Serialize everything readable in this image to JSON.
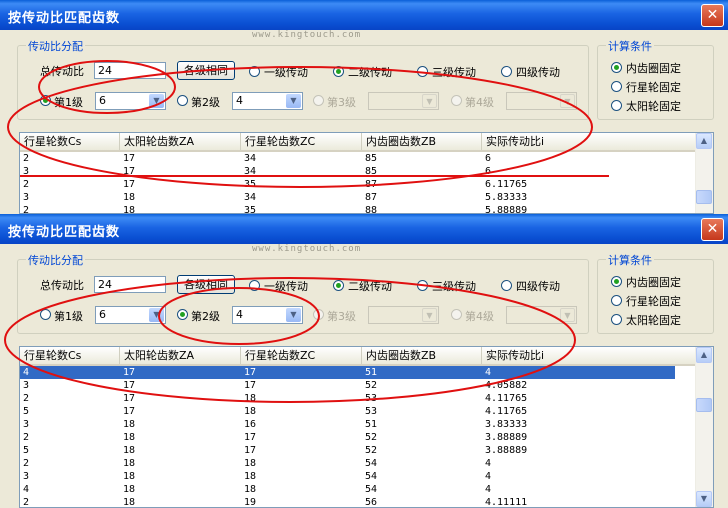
{
  "windows": [
    {
      "title": "按传动比匹配齿数",
      "watermark": "www.kingtouch.com",
      "ratio_group": {
        "title": "传动比分配",
        "total_ratio_label": "总传动比",
        "total_ratio_value": "24",
        "equal_button": "各级相同",
        "stage_options": [
          "一级传动",
          "二级传动",
          "三级传动",
          "四级传动"
        ],
        "selected_stage_index": 1,
        "levels": [
          {
            "label": "第1级",
            "value": "6",
            "selected": true,
            "enabled": true
          },
          {
            "label": "第2级",
            "value": "4",
            "selected": false,
            "enabled": true
          },
          {
            "label": "第3级",
            "value": "",
            "selected": false,
            "enabled": false
          },
          {
            "label": "第4级",
            "value": "",
            "selected": false,
            "enabled": false
          }
        ]
      },
      "condition_group": {
        "title": "计算条件",
        "options": [
          "内齿圈固定",
          "行星轮固定",
          "太阳轮固定"
        ],
        "selected_index": 0
      },
      "table": {
        "columns": [
          "行星轮数Cs",
          "太阳轮齿数ZA",
          "行星轮齿数ZC",
          "内齿圈齿数ZB",
          "实际传动比i"
        ],
        "rows": [
          [
            "2",
            "17",
            "34",
            "85",
            "6"
          ],
          [
            "3",
            "17",
            "34",
            "85",
            "6"
          ],
          [
            "2",
            "17",
            "35",
            "87",
            "6.11765"
          ],
          [
            "3",
            "18",
            "34",
            "87",
            "5.83333"
          ],
          [
            "2",
            "18",
            "35",
            "88",
            "5.88889"
          ]
        ],
        "selected_row": -1
      }
    },
    {
      "title": "按传动比匹配齿数",
      "watermark": "www.kingtouch.com",
      "ratio_group": {
        "title": "传动比分配",
        "total_ratio_label": "总传动比",
        "total_ratio_value": "24",
        "equal_button": "各级相同",
        "stage_options": [
          "一级传动",
          "二级传动",
          "三级传动",
          "四级传动"
        ],
        "selected_stage_index": 1,
        "levels": [
          {
            "label": "第1级",
            "value": "6",
            "selected": false,
            "enabled": true
          },
          {
            "label": "第2级",
            "value": "4",
            "selected": true,
            "enabled": true
          },
          {
            "label": "第3级",
            "value": "",
            "selected": false,
            "enabled": false
          },
          {
            "label": "第4级",
            "value": "",
            "selected": false,
            "enabled": false
          }
        ]
      },
      "condition_group": {
        "title": "计算条件",
        "options": [
          "内齿圈固定",
          "行星轮固定",
          "太阳轮固定"
        ],
        "selected_index": 0
      },
      "table": {
        "columns": [
          "行星轮数Cs",
          "太阳轮齿数ZA",
          "行星轮齿数ZC",
          "内齿圈齿数ZB",
          "实际传动比i"
        ],
        "rows": [
          [
            "4",
            "17",
            "17",
            "51",
            "4"
          ],
          [
            "3",
            "17",
            "17",
            "52",
            "4.05882"
          ],
          [
            "2",
            "17",
            "18",
            "53",
            "4.11765"
          ],
          [
            "5",
            "17",
            "18",
            "53",
            "4.11765"
          ],
          [
            "3",
            "18",
            "16",
            "51",
            "3.83333"
          ],
          [
            "2",
            "18",
            "17",
            "52",
            "3.88889"
          ],
          [
            "5",
            "18",
            "17",
            "52",
            "3.88889"
          ],
          [
            "2",
            "18",
            "18",
            "54",
            "4"
          ],
          [
            "3",
            "18",
            "18",
            "54",
            "4"
          ],
          [
            "4",
            "18",
            "18",
            "54",
            "4"
          ],
          [
            "2",
            "18",
            "19",
            "56",
            "4.11111"
          ]
        ],
        "selected_row": 0
      }
    }
  ],
  "annotation_color": "#e01010"
}
